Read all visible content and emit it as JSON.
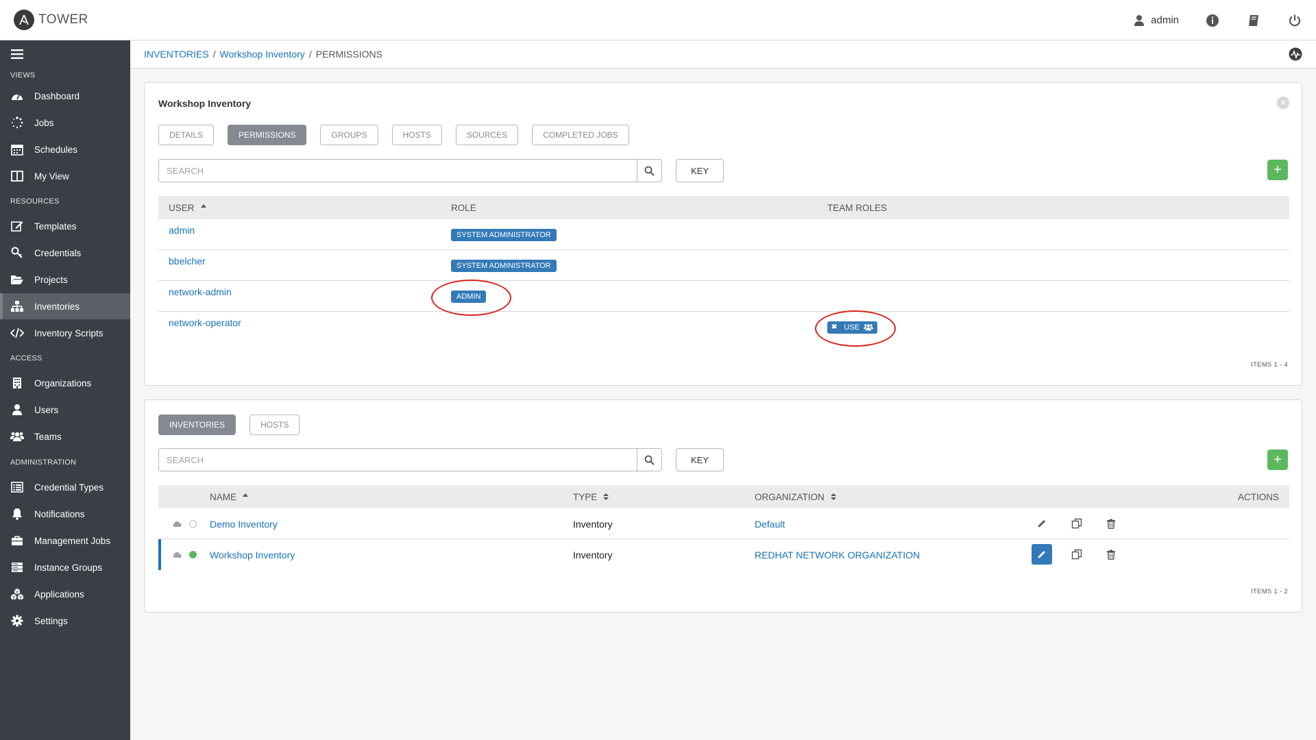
{
  "app": {
    "name": "TOWER"
  },
  "topbar": {
    "username": "admin"
  },
  "sidebar": {
    "sections": [
      {
        "label": "VIEWS"
      },
      {
        "label": "RESOURCES"
      },
      {
        "label": "ACCESS"
      },
      {
        "label": "ADMINISTRATION"
      }
    ],
    "items": [
      {
        "label": "Dashboard",
        "icon": "dashboard-icon"
      },
      {
        "label": "Jobs",
        "icon": "jobs-icon"
      },
      {
        "label": "Schedules",
        "icon": "calendar-icon"
      },
      {
        "label": "My View",
        "icon": "columns-icon"
      },
      {
        "label": "Templates",
        "icon": "pencil-square-icon"
      },
      {
        "label": "Credentials",
        "icon": "key-icon"
      },
      {
        "label": "Projects",
        "icon": "folder-icon"
      },
      {
        "label": "Inventories",
        "icon": "sitemap-icon",
        "active": true
      },
      {
        "label": "Inventory Scripts",
        "icon": "code-icon"
      },
      {
        "label": "Organizations",
        "icon": "building-icon"
      },
      {
        "label": "Users",
        "icon": "user-icon"
      },
      {
        "label": "Teams",
        "icon": "users-icon"
      },
      {
        "label": "Credential Types",
        "icon": "list-alt-icon"
      },
      {
        "label": "Notifications",
        "icon": "bell-icon"
      },
      {
        "label": "Management Jobs",
        "icon": "briefcase-icon"
      },
      {
        "label": "Instance Groups",
        "icon": "server-icon"
      },
      {
        "label": "Applications",
        "icon": "cubes-icon"
      },
      {
        "label": "Settings",
        "icon": "cog-icon"
      }
    ]
  },
  "breadcrumb": {
    "root": "INVENTORIES",
    "sep1": "/",
    "parent": "Workshop Inventory",
    "sep2": "/",
    "current": "PERMISSIONS"
  },
  "permissions_panel": {
    "title": "Workshop Inventory",
    "tabs": [
      "DETAILS",
      "PERMISSIONS",
      "GROUPS",
      "HOSTS",
      "SOURCES",
      "COMPLETED JOBS"
    ],
    "active_tab": "PERMISSIONS",
    "search_placeholder": "SEARCH",
    "key_label": "KEY",
    "add_label": "+",
    "columns": {
      "user": "USER",
      "role": "ROLE",
      "team_roles": "TEAM ROLES"
    },
    "rows": [
      {
        "user": "admin",
        "role": "SYSTEM ADMINISTRATOR",
        "team_role": ""
      },
      {
        "user": "bbelcher",
        "role": "SYSTEM ADMINISTRATOR",
        "team_role": ""
      },
      {
        "user": "network-admin",
        "role": "ADMIN",
        "team_role": ""
      },
      {
        "user": "network-operator",
        "role": "",
        "team_role": "USE"
      }
    ],
    "items_label": "ITEMS  1 - 4"
  },
  "inventories_panel": {
    "tabs": [
      "INVENTORIES",
      "HOSTS"
    ],
    "active_tab": "INVENTORIES",
    "search_placeholder": "SEARCH",
    "key_label": "KEY",
    "add_label": "+",
    "columns": {
      "name": "NAME",
      "type": "TYPE",
      "organization": "ORGANIZATION",
      "actions": "ACTIONS"
    },
    "rows": [
      {
        "name": "Demo Inventory",
        "type": "Inventory",
        "organization": "Default",
        "status": "none",
        "selected": false
      },
      {
        "name": "Workshop Inventory",
        "type": "Inventory",
        "organization": "REDHAT NETWORK ORGANIZATION",
        "status": "ok",
        "selected": true
      }
    ],
    "items_label": "ITEMS  1 - 2"
  },
  "colors": {
    "sidebar": "#393f44",
    "link": "#1a72b9",
    "badge": "#337ab7",
    "success": "#5cb85c",
    "highlight_annotation": "#d9211f"
  }
}
